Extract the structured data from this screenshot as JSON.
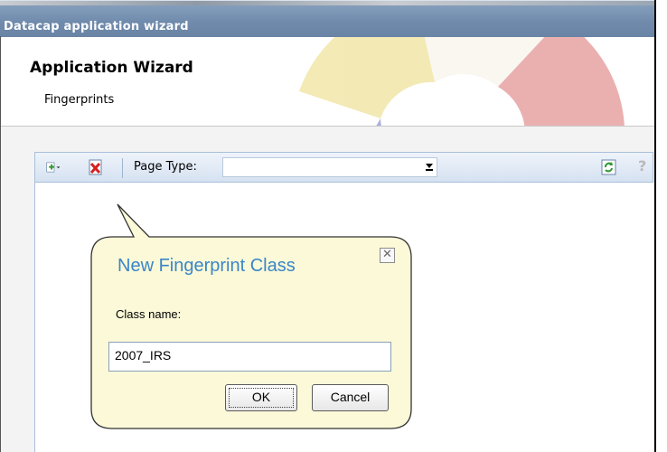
{
  "window": {
    "title": "Datacap application wizard"
  },
  "header": {
    "title": "Application Wizard",
    "subtitle": "Fingerprints"
  },
  "toolbar": {
    "page_type_label": "Page Type:",
    "page_type_value": "",
    "icons": [
      "add-dropdown-icon",
      "delete-icon",
      "refresh-icon",
      "help-icon"
    ],
    "help_glyph": "?"
  },
  "popup": {
    "title": "New Fingerprint Class",
    "close_glyph": "✕",
    "class_name_label": "Class name:",
    "class_name_value": "2007_IRS",
    "ok_label": "OK",
    "cancel_label": "Cancel"
  },
  "colors": {
    "titlebar": "#7590b0",
    "toolbar": "#dfe8f5",
    "popup_bg": "#fbf9d8",
    "popup_title": "#3a86c8"
  }
}
